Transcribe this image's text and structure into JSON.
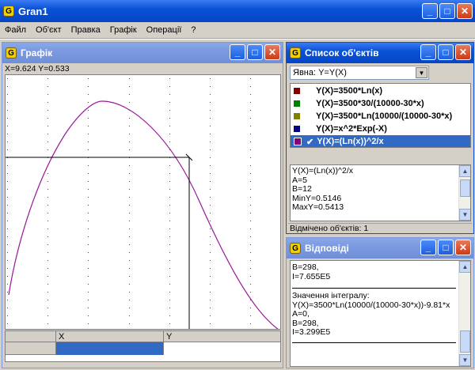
{
  "app": {
    "title": "Gran1"
  },
  "menu": [
    "Файл",
    "Об'єкт",
    "Правка",
    "Графік",
    "Операції",
    "?"
  ],
  "graph_window": {
    "title": "Графік",
    "coords": "X=9.624  Y=0.533",
    "table_headers": [
      "",
      "X",
      "Y"
    ]
  },
  "list_window": {
    "title": "Список об'єктів",
    "dropdown": "Явна: Y=Y(X)",
    "items": [
      {
        "label": "Y(X)=3500*Ln(x)",
        "color": "#800000",
        "checked": false,
        "selected": false
      },
      {
        "label": "Y(X)=3500*30/(10000-30*x)",
        "color": "#008000",
        "checked": false,
        "selected": false
      },
      {
        "label": "Y(X)=3500*Ln(10000/(10000-30*x)",
        "color": "#808000",
        "checked": false,
        "selected": false
      },
      {
        "label": "Y(X)=x^2*Exp(-X)",
        "color": "#000080",
        "checked": false,
        "selected": false
      },
      {
        "label": "Y(X)=(Ln(x))^2/x",
        "color": "#800080",
        "checked": true,
        "selected": true
      }
    ],
    "info_lines": [
      "Y(X)=(Ln(x))^2/x",
      "A=5",
      "B=12",
      "MinY=0.5146",
      "MaxY=0.5413"
    ],
    "status": "Відмічено об'єктів: 1"
  },
  "answers_window": {
    "title": "Відповіді",
    "block1": [
      "B=298,",
      "I=7.655E5"
    ],
    "block2": [
      "Значення інтегралу:",
      "Y(X)=3500*Ln(10000/(10000-30*x))-9.81*x",
      "A=0,",
      "B=298,",
      "I=3.299E5"
    ]
  },
  "icons": {
    "app": "G",
    "minimize": "minimize-icon",
    "maximize": "maximize-icon",
    "close": "close-icon"
  }
}
